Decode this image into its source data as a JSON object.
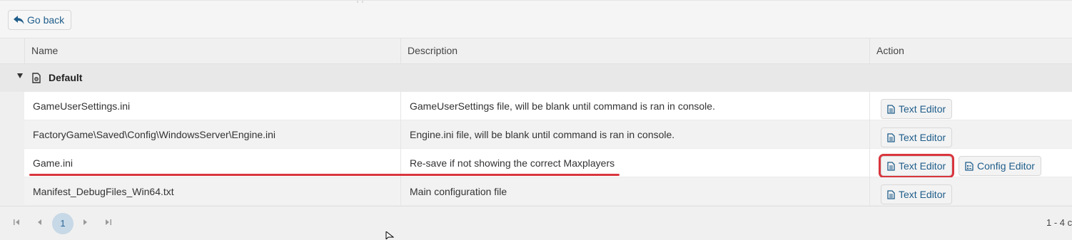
{
  "toolbar": {
    "back_label": "Go back"
  },
  "table": {
    "columns": {
      "name": "Name",
      "description": "Description",
      "action": "Action"
    },
    "group": {
      "label": "Default"
    },
    "rows": [
      {
        "name": "GameUserSettings.ini",
        "description": "GameUserSettings file, will be blank until command is ran in console.",
        "actions": [
          "Text Editor"
        ]
      },
      {
        "name": "FactoryGame\\Saved\\Config\\WindowsServer\\Engine.ini",
        "description": "Engine.ini file, will be blank until command is ran in console.",
        "actions": [
          "Text Editor"
        ]
      },
      {
        "name": "Game.ini",
        "description": "Re-save if not showing the correct Maxplayers",
        "actions": [
          "Text Editor",
          "Config Editor"
        ]
      },
      {
        "name": "Manifest_DebugFiles_Win64.txt",
        "description": "Main configuration file",
        "actions": [
          "Text Editor"
        ]
      }
    ]
  },
  "pager": {
    "current_page": "1",
    "summary": "1 - 4 c"
  },
  "colors": {
    "accent": "#1f5d8b",
    "highlight": "#d9363e",
    "page_active_bg": "#c7d8e6"
  }
}
